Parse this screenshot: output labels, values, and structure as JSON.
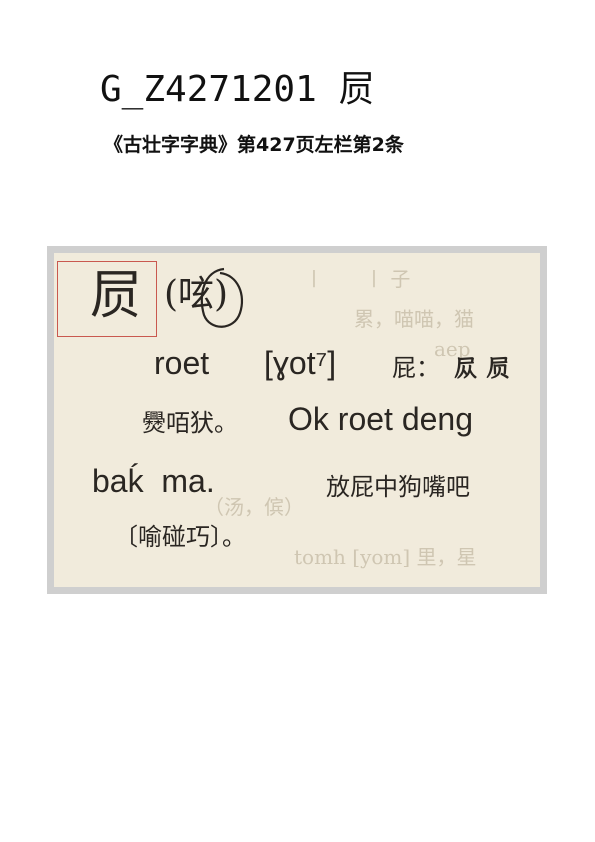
{
  "header": {
    "code": "G_Z4271201",
    "glyph": "屃"
  },
  "source": "《古壮字字典》第427页左栏第2条",
  "entry": {
    "headword": "屃",
    "variant": "(呟)",
    "line1_roman": "roet",
    "line1_ipa": "[ɣot⁷]",
    "line1_gloss": "屁：",
    "line1_gloss_chars": "𪨊 屃",
    "line2_chars": "㸑咟犾。",
    "line2_roman": "Ok roet deng",
    "line3_roman": "baḱ  ma.",
    "line3_gloss": "放屁中狗嘴吧",
    "line4_note": "〔喻碰巧〕。"
  },
  "colors": {
    "paper": "#f1ebdc",
    "frame": "#cfcfcf",
    "ink": "#2a2622",
    "highlight_box": "#c9584f"
  }
}
